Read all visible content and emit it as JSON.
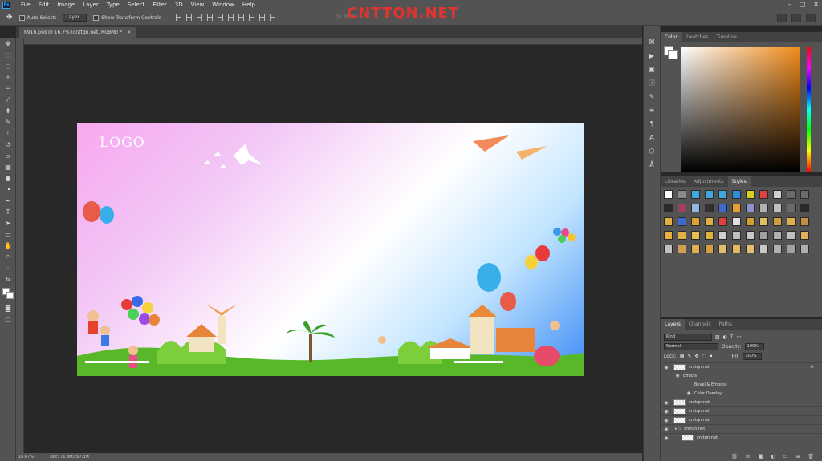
{
  "app": {
    "logo": "Ps",
    "menu": [
      "File",
      "Edit",
      "Image",
      "Layer",
      "Type",
      "Select",
      "Filter",
      "3D",
      "View",
      "Window",
      "Help"
    ],
    "window_controls": [
      "–",
      "□",
      "✕"
    ]
  },
  "options_bar": {
    "auto_select_label": "Auto-Select:",
    "auto_select_value": "Layer",
    "transform_label": "Show Transform Controls",
    "mode_label": "3D Mode:"
  },
  "watermark": "CNTTQN.NET",
  "document": {
    "tab_title": "6916.psd @ 16.7% (cnttqn.net, RGB/8) *",
    "close": "×",
    "artwork_logo": "LOGO"
  },
  "status": {
    "zoom": "16.67%",
    "doc_size": "Doc: 71.8M/267.3M"
  },
  "color_panel": {
    "tabs": [
      "Color",
      "Swatches",
      "Timeline"
    ],
    "active": "Color"
  },
  "styles_panel": {
    "tabs": [
      "Libraries",
      "Adjustments",
      "Styles"
    ],
    "active": "Styles",
    "swatch_colors": [
      "#ffffff",
      "#8a8a8a",
      "#3fa9dc",
      "#3fa9dc",
      "#3fa9dc",
      "#2b8fd6",
      "#d8d020",
      "#e04040",
      "#d0d0d0",
      "#6a6a6a",
      "#6a6a6a",
      "#2a2a2a",
      "#a04060",
      "#90b8e0",
      "#303030",
      "#3c6ad0",
      "#e8a030",
      "#9090d0",
      "#b0b0b0",
      "#c0c0c0",
      "#6a6a6a",
      "#2a2a2a",
      "#e0b040",
      "#3c6ad0",
      "#e0a030",
      "#e0b040",
      "#e04040",
      "#e0e0e0",
      "#d0a030",
      "#e0c060",
      "#d0a040",
      "#e0b050",
      "#c09040",
      "#e8b040",
      "#e0b040",
      "#e8c050",
      "#e0b040",
      "#d0d0d0",
      "#c0c0c0",
      "#c8c8c8",
      "#a0a0a0",
      "#b0b0b0",
      "#c0c0c0",
      "#e0b060",
      "#c0c0c0",
      "#d0a050",
      "#e0b050",
      "#d0a040",
      "#e0c070",
      "#e8b860",
      "#e0c070",
      "#c8c8c8",
      "#b0b0b0",
      "#a0a0a0",
      "#b0b0b0"
    ]
  },
  "layers_panel": {
    "tabs": [
      "Layers",
      "Channels",
      "Paths"
    ],
    "active": "Layers",
    "filter_kind": "Kind",
    "blend_mode": "Normal",
    "opacity_label": "Opacity:",
    "opacity_value": "100%",
    "lock_label": "Lock:",
    "fill_label": "Fill:",
    "fill_value": "100%",
    "rows": [
      {
        "name": "cnttqn.net",
        "fx": "fx"
      },
      {
        "name": "Effects"
      },
      {
        "name": "Bevel & Emboss"
      },
      {
        "name": "Color Overlay"
      },
      {
        "name": "cnttqn.net"
      },
      {
        "name": "cnttqn.net"
      },
      {
        "name": "cnttqn.net"
      },
      {
        "name": "cnttqn.net"
      },
      {
        "name": "cnttqn.net"
      }
    ]
  }
}
